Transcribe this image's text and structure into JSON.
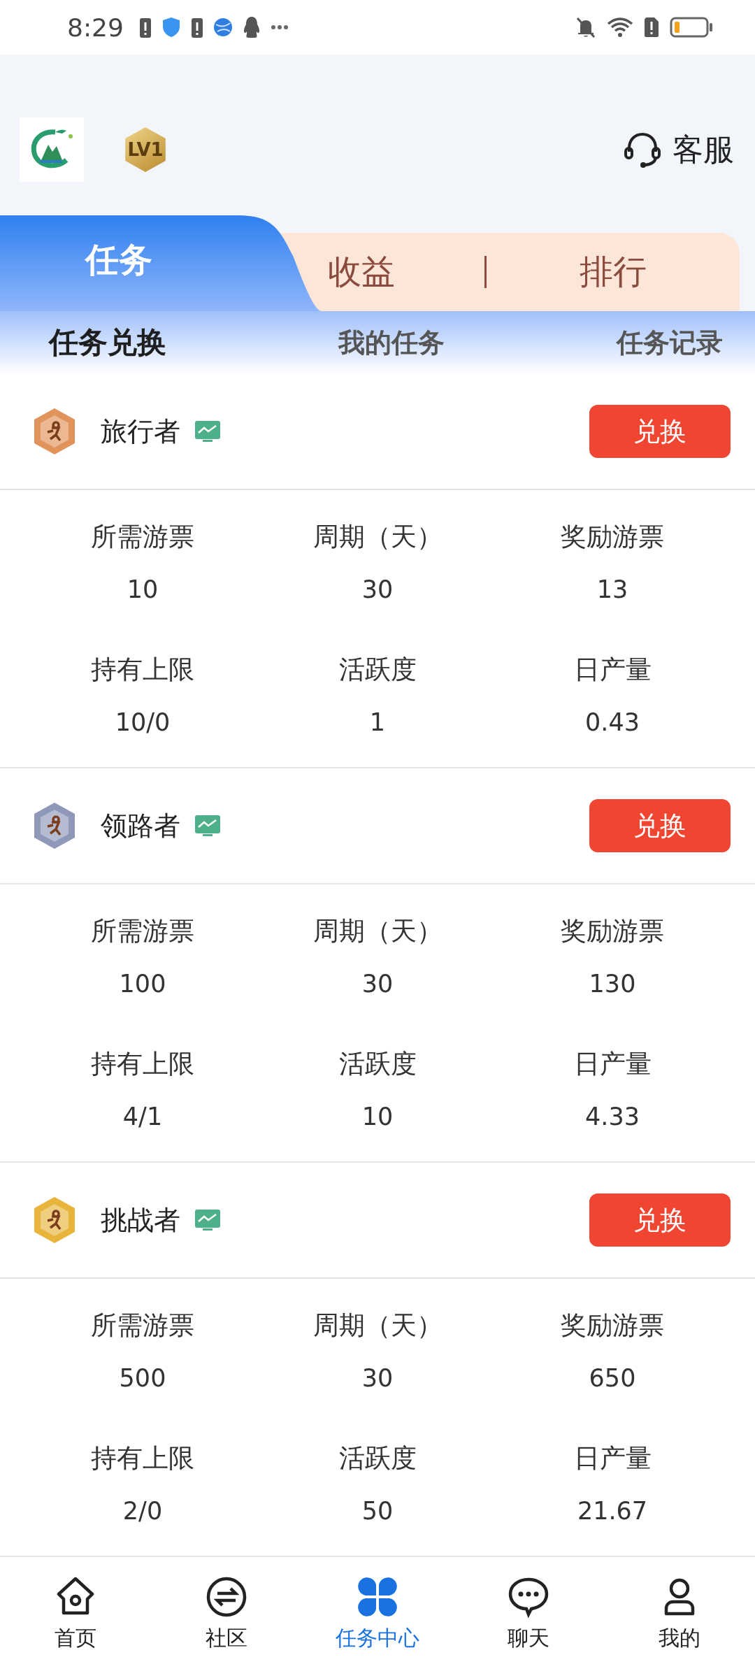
{
  "status_bar": {
    "time": "8:29"
  },
  "header": {
    "level_badge": "LV1",
    "service_label": "客服"
  },
  "main_tabs": [
    {
      "label": "任务",
      "selected": true
    },
    {
      "label": "收益",
      "selected": false
    },
    {
      "label": "排行",
      "selected": false
    }
  ],
  "sub_tabs": [
    {
      "label": "任务兑换",
      "selected": true
    },
    {
      "label": "我的任务",
      "selected": false
    },
    {
      "label": "任务记录",
      "selected": false
    }
  ],
  "tasks": [
    {
      "name": "旅行者",
      "color": "#e0935a",
      "button": "兑换",
      "stats": [
        {
          "label": "所需游票",
          "value": "10"
        },
        {
          "label": "周期（天）",
          "value": "30"
        },
        {
          "label": "奖励游票",
          "value": "13"
        },
        {
          "label": "持有上限",
          "value": "10/0"
        },
        {
          "label": "活跃度",
          "value": "1"
        },
        {
          "label": "日产量",
          "value": "0.43"
        }
      ]
    },
    {
      "name": "领路者",
      "color": "#8e98b8",
      "button": "兑换",
      "stats": [
        {
          "label": "所需游票",
          "value": "100"
        },
        {
          "label": "周期（天）",
          "value": "30"
        },
        {
          "label": "奖励游票",
          "value": "130"
        },
        {
          "label": "持有上限",
          "value": "4/1"
        },
        {
          "label": "活跃度",
          "value": "10"
        },
        {
          "label": "日产量",
          "value": "4.33"
        }
      ]
    },
    {
      "name": "挑战者",
      "color": "#e8b43c",
      "button": "兑换",
      "stats": [
        {
          "label": "所需游票",
          "value": "500"
        },
        {
          "label": "周期（天）",
          "value": "30"
        },
        {
          "label": "奖励游票",
          "value": "650"
        },
        {
          "label": "持有上限",
          "value": "2/0"
        },
        {
          "label": "活跃度",
          "value": "50"
        },
        {
          "label": "日产量",
          "value": "21.67"
        }
      ]
    }
  ],
  "bottom_nav": [
    {
      "label": "首页",
      "kind": "home",
      "selected": false
    },
    {
      "label": "社区",
      "kind": "community",
      "selected": false
    },
    {
      "label": "任务中心",
      "kind": "tasks",
      "selected": true
    },
    {
      "label": "聊天",
      "kind": "chat",
      "selected": false
    },
    {
      "label": "我的",
      "kind": "profile",
      "selected": false
    }
  ]
}
